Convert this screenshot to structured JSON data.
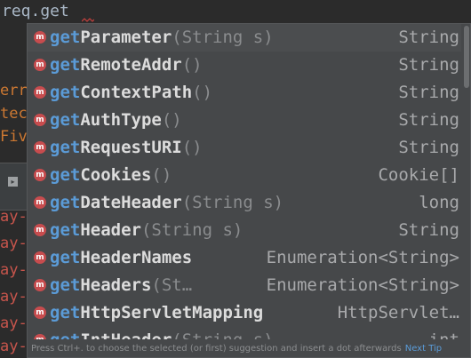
{
  "editor": {
    "line_text": "req.get"
  },
  "left_fragments": [
    {
      "text": "err",
      "color": "#cc7832"
    },
    {
      "text": "tec",
      "color": "#cc7832"
    },
    {
      "text": "Fiv",
      "color": "#cc7832"
    },
    {
      "text": "ay-",
      "color": "#c7554c"
    },
    {
      "text": "ay-",
      "color": "#c7554c"
    },
    {
      "text": "ay-",
      "color": "#c7554c"
    },
    {
      "text": "ay-",
      "color": "#c7554c"
    },
    {
      "text": "ay-",
      "color": "#c7554c"
    },
    {
      "text": "ay-",
      "color": "#c7554c"
    }
  ],
  "completion": {
    "items": [
      {
        "icon": "m",
        "prefix": "get",
        "rest": "Parameter",
        "sig": "(String s)",
        "type": "String"
      },
      {
        "icon": "m",
        "prefix": "get",
        "rest": "RemoteAddr",
        "sig": "()",
        "type": "String"
      },
      {
        "icon": "m",
        "prefix": "get",
        "rest": "ContextPath",
        "sig": "()",
        "type": "String"
      },
      {
        "icon": "m",
        "prefix": "get",
        "rest": "AuthType",
        "sig": "()",
        "type": "String"
      },
      {
        "icon": "m",
        "prefix": "get",
        "rest": "RequestURI",
        "sig": "()",
        "type": "String"
      },
      {
        "icon": "m",
        "prefix": "get",
        "rest": "Cookies",
        "sig": "()",
        "type": "Cookie[]"
      },
      {
        "icon": "m",
        "prefix": "get",
        "rest": "DateHeader",
        "sig": "(String s)",
        "type": "long"
      },
      {
        "icon": "m",
        "prefix": "get",
        "rest": "Header",
        "sig": "(String s)",
        "type": "String"
      },
      {
        "icon": "m",
        "prefix": "get",
        "rest": "HeaderNames",
        "sig": "",
        "type": "Enumeration<String>"
      },
      {
        "icon": "m",
        "prefix": "get",
        "rest": "Headers",
        "sig": "(St…",
        "type": "Enumeration<String>"
      },
      {
        "icon": "m",
        "prefix": "get",
        "rest": "HttpServletMapping",
        "sig": "",
        "type": "HttpServlet…"
      },
      {
        "icon": "m",
        "prefix": "get",
        "rest": "IntHeader",
        "sig": "(String s)",
        "type": "int"
      }
    ],
    "footer_hint": "Press Ctrl+. to choose the selected (or first) suggestion and insert a dot afterwards",
    "footer_tip": "Next Tip"
  },
  "colors": {
    "method_icon": "#c74c4e",
    "match_prefix": "#5b9bd7",
    "popup_bg": "#46484a",
    "editor_bg": "#2b2b2b"
  }
}
